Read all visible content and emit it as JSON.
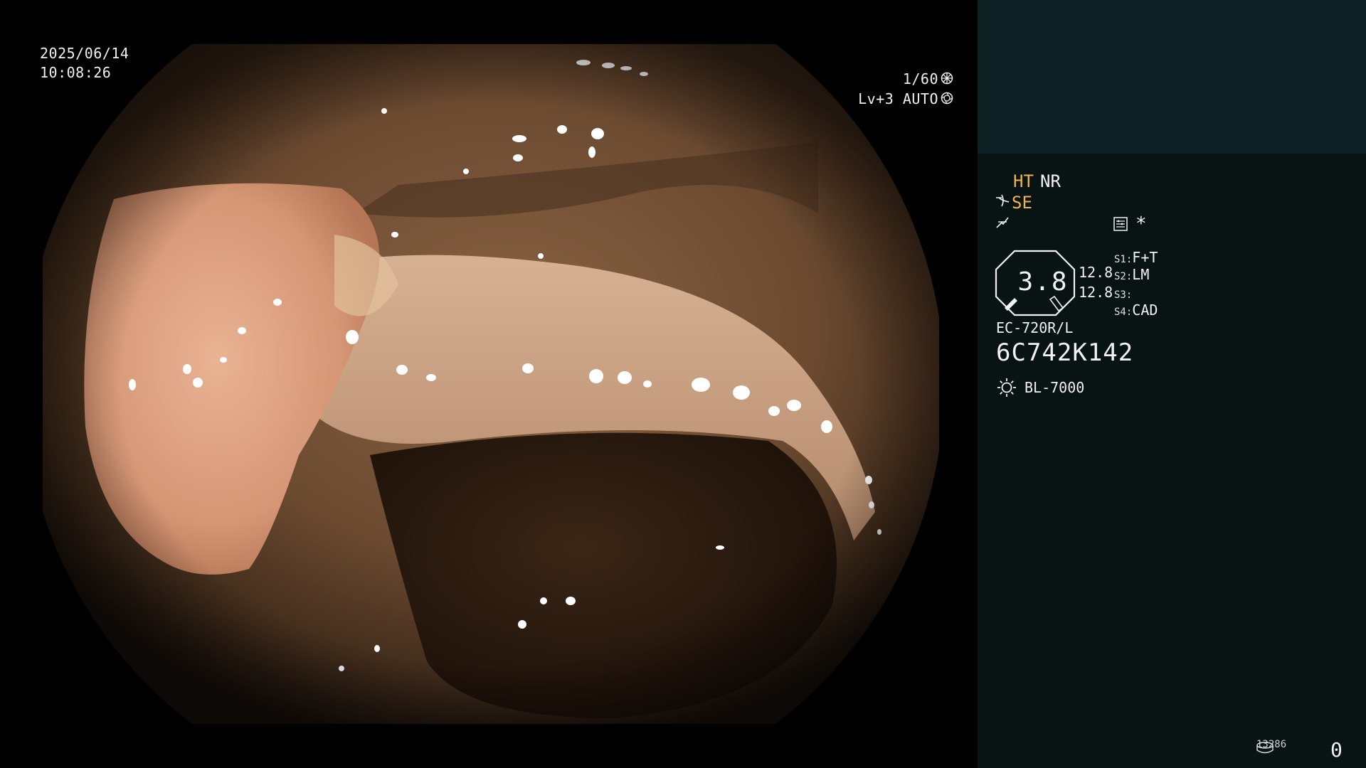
{
  "video": {
    "date": "2025/06/14",
    "time": "10:08:26",
    "shutter": "1/60",
    "level": "Lv+3 AUTO"
  },
  "panel": {
    "ht": "HT",
    "nr": "NR",
    "se": "SE",
    "star": "*",
    "gauge_value": "3.8",
    "value_1": "12.8",
    "value_2": "12.8",
    "slots": [
      {
        "key": "S1:",
        "value": "F+T"
      },
      {
        "key": "S2:",
        "value": "LM"
      },
      {
        "key": "S3:",
        "value": ""
      },
      {
        "key": "S4:",
        "value": "CAD"
      }
    ],
    "scope_model": "EC-720R/L",
    "scope_serial": "6C742K142",
    "light_source": "BL-7000",
    "counter": "13286",
    "corner_value": "0"
  },
  "colors": {
    "accent_orange": "#f2b24a",
    "panel_top": "#0d2124",
    "panel_bottom": "#081314"
  },
  "icons": [
    "shutter-icon",
    "iris-icon",
    "se-wave-icon",
    "edge-icon",
    "menu-icon",
    "sun-icon",
    "storage-icon"
  ]
}
